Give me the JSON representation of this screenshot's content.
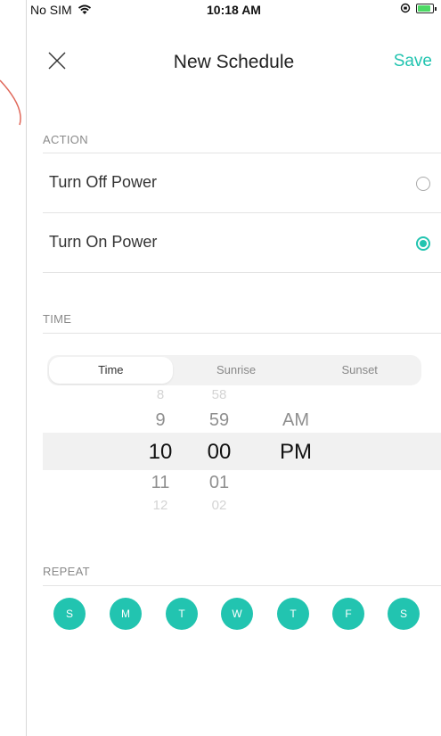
{
  "status_bar": {
    "carrier": "No SIM",
    "time": "10:18 AM"
  },
  "nav": {
    "title": "New Schedule",
    "save_label": "Save"
  },
  "action": {
    "section_label": "ACTION",
    "options": [
      {
        "label": "Turn Off Power",
        "selected": false
      },
      {
        "label": "Turn On Power",
        "selected": true
      }
    ]
  },
  "time": {
    "section_label": "TIME",
    "modes": [
      "Time",
      "Sunrise",
      "Sunset"
    ],
    "active_mode": "Time",
    "picker": {
      "hours": [
        "8",
        "9",
        "10",
        "11",
        "12"
      ],
      "minutes": [
        "58",
        "59",
        "00",
        "01",
        "02"
      ],
      "periods": [
        "AM",
        "PM"
      ],
      "selected_hour": "10",
      "selected_minute": "00",
      "selected_period": "PM"
    }
  },
  "repeat": {
    "section_label": "REPEAT",
    "days": [
      "S",
      "M",
      "T",
      "W",
      "T",
      "F",
      "S"
    ]
  },
  "colors": {
    "accent": "#22c4b0"
  }
}
